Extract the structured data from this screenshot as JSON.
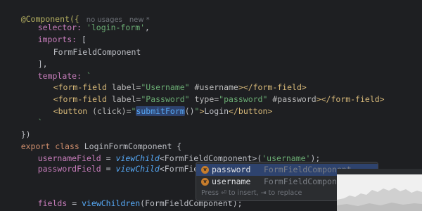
{
  "editor": {
    "annotation": "@Component({",
    "usage_hint": "no usages",
    "new_hint": "new *",
    "selector_key": "selector:",
    "selector_value": "'login-form'",
    "selector_comma": ",",
    "imports_key": "imports:",
    "imports_open": "[",
    "import_item": "FormFieldComponent",
    "imports_close": "],",
    "template_key": "template:",
    "template_open": "`",
    "tpl_line1": {
      "open": "<form-field",
      "attr1": "label=",
      "val1": "\"Username\"",
      "ref": "#username",
      "close": "></form-field>"
    },
    "tpl_line2": {
      "open": "<form-field",
      "attr1": "label=",
      "val1": "\"Password\"",
      "attr2": "type=",
      "val2": "\"password\"",
      "ref": "#password",
      "close": "></form-field>"
    },
    "tpl_line3": {
      "open": "<button",
      "attr": "(click)=",
      "quote_open": "\"",
      "call": "submitForm",
      "parens": "()",
      "quote_close": "\"",
      "gt": ">",
      "text": "Login",
      "close": "</button>"
    },
    "template_close": "`",
    "decorator_close": "})",
    "class_kw1": "export",
    "class_kw2": "class",
    "class_name": "LoginFormComponent {",
    "field1_name": "usernameField",
    "field1_eq": "=",
    "field1_call": "viewChild",
    "field1_generic": "<FormFieldComponent>(",
    "field1_arg": "'username'",
    "field1_end": ");",
    "field2_name": "passwordField",
    "field2_eq": "=",
    "field2_call": "viewChild",
    "field2_generic": "<FormFieldComponent>(",
    "field2_q1": "'",
    "field2_q2": "'",
    "field2_end": ");",
    "field3_name": "fields",
    "field3_eq": "=",
    "field3_call": "viewChildren",
    "field3_rest": "(FormFieldComponent);"
  },
  "completion": {
    "items": [
      {
        "badge": "v",
        "name": "password",
        "type": "FormFieldComponent"
      },
      {
        "badge": "v",
        "name": "username",
        "type": "FormFieldComponent"
      }
    ],
    "hint": "Press ⏎ to insert, ⇥ to replace"
  },
  "colors": {
    "background": "#1e1f22",
    "keyword": "#cf8e6d",
    "string": "#6aab73",
    "property": "#c77dbb",
    "function": "#56a8f5",
    "tag": "#d5b778",
    "annotation": "#b3ae60",
    "selection": "#2e436e"
  }
}
